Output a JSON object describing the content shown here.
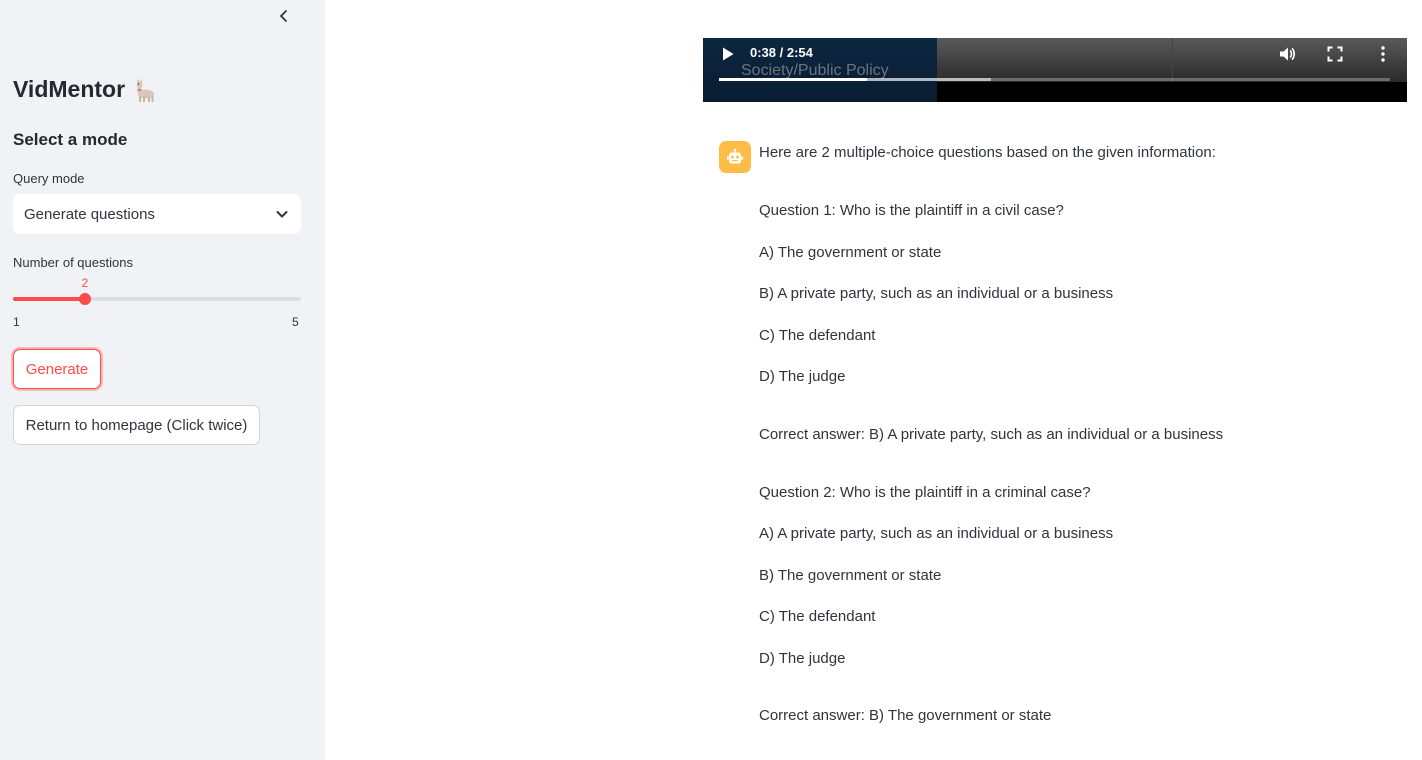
{
  "sidebar": {
    "app_title": "VidMentor",
    "mode_heading": "Select a mode",
    "query_mode_label": "Query mode",
    "query_mode_value": "Generate questions",
    "num_questions_label": "Number of questions",
    "slider": {
      "value": "2",
      "min": "1",
      "max": "5"
    },
    "generate_label": "Generate",
    "return_label": "Return to homepage (Click twice)"
  },
  "video": {
    "time": "0:38 / 2:54",
    "subtitle": "Society/Public Policy",
    "played_fraction": 0.22,
    "buffered_fraction": 0.405
  },
  "chat": {
    "intro": "Here are 2 multiple-choice questions based on the given information:",
    "q1": {
      "question": "Question 1: Who is the plaintiff in a civil case?",
      "a": "A) The government or state",
      "b": "B) A private party, such as an individual or a business",
      "c": "C) The defendant",
      "d": "D) The judge",
      "answer": "Correct answer: B) A private party, such as an individual or a business"
    },
    "q2": {
      "question": "Question 2: Who is the plaintiff in a criminal case?",
      "a": "A) A private party, such as an individual or a business",
      "b": "B) The government or state",
      "c": "C) The defendant",
      "d": "D) The judge",
      "answer": "Correct answer: B) The government or state"
    }
  },
  "icons": {
    "collapse": "chevron-left-icon",
    "select": "chevron-down-icon",
    "avatar": "robot-icon",
    "play": "play-icon",
    "volume": "volume-icon",
    "fullscreen": "fullscreen-icon",
    "more": "more-vertical-icon",
    "logo": "llama-icon"
  },
  "colors": {
    "accent": "#ff4b4b",
    "sidebar_bg": "#f0f2f6",
    "avatar_bg": "#ffbd45"
  }
}
